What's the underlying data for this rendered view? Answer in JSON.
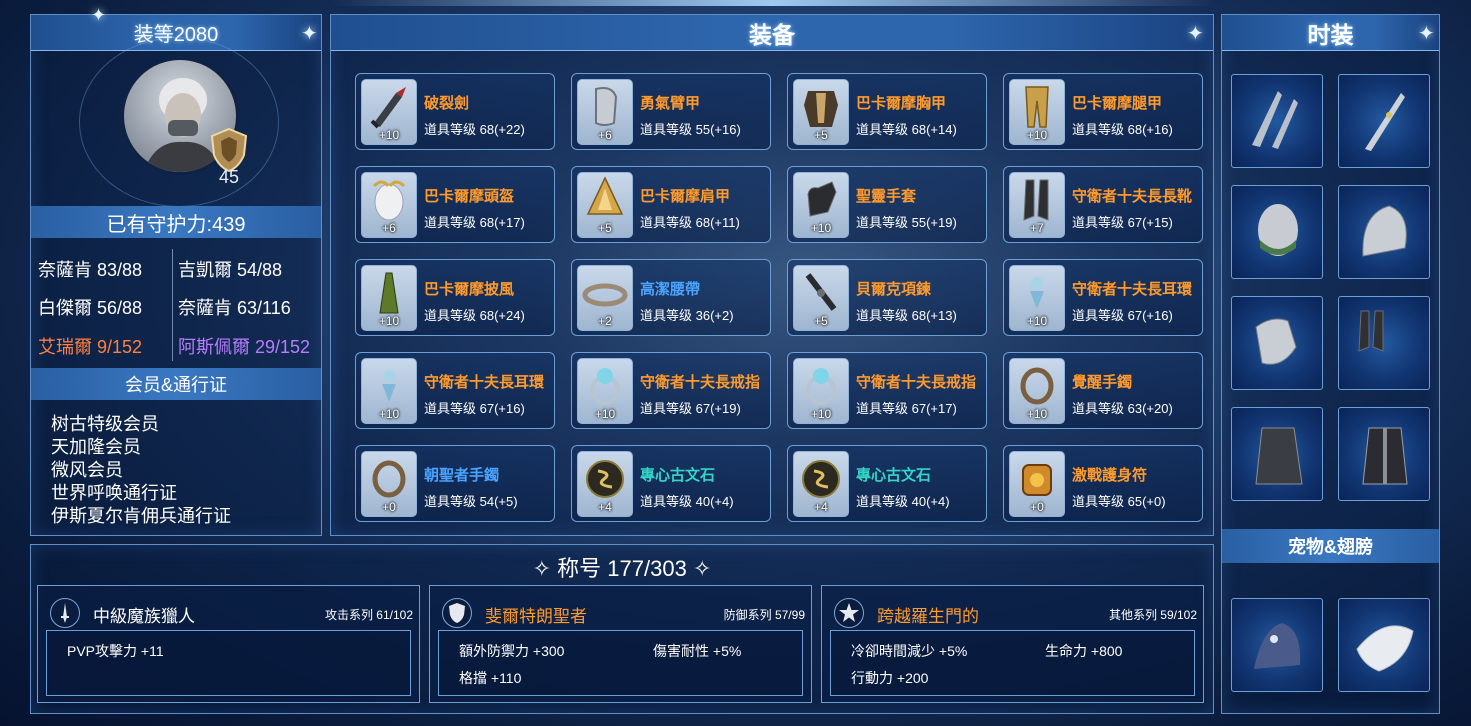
{
  "colors": {
    "orange": "#ff9a2b",
    "teal": "#35d6c8",
    "blue": "#4aa3ff",
    "purple": "#b77dff",
    "rare_orange": "#ff8040"
  },
  "left": {
    "gear_score": "装等2080",
    "avatar_level": "45",
    "guard_power": "已有守护力:439",
    "stats": [
      {
        "label": "奈薩肯 83/88"
      },
      {
        "label": "吉凱爾 54/88"
      },
      {
        "label": "白傑爾 56/88"
      },
      {
        "label": "奈薩肯 63/116"
      },
      {
        "label": "艾瑞爾 9/152"
      },
      {
        "label": "阿斯佩爾 29/152"
      }
    ],
    "membership_title": "会员&通行证",
    "memberships": [
      "树古特级会员",
      "天加隆会员",
      "微风会员",
      "世界呼唤通行证",
      "伊斯夏尔肯佣兵通行证"
    ]
  },
  "equipment": {
    "title": "装备",
    "items": [
      {
        "name": "破裂劍",
        "level": "道具等级 68(+22)",
        "plus": "+10",
        "color": "orange",
        "icon": "sword-icon"
      },
      {
        "name": "勇氣臂甲",
        "level": "道具等级 55(+16)",
        "plus": "+6",
        "color": "orange",
        "icon": "vambrace-icon"
      },
      {
        "name": "巴卡爾摩胸甲",
        "level": "道具等级 68(+14)",
        "plus": "+5",
        "color": "orange",
        "icon": "chest-armor-icon"
      },
      {
        "name": "巴卡爾摩腿甲",
        "level": "道具等级 68(+16)",
        "plus": "+10",
        "color": "orange",
        "icon": "leg-armor-icon"
      },
      {
        "name": "巴卡爾摩頭盔",
        "level": "道具等级 68(+17)",
        "plus": "+6",
        "color": "orange",
        "icon": "helmet-icon"
      },
      {
        "name": "巴卡爾摩肩甲",
        "level": "道具等级 68(+11)",
        "plus": "+5",
        "color": "orange",
        "icon": "shoulder-icon"
      },
      {
        "name": "聖靈手套",
        "level": "道具等级 55(+19)",
        "plus": "+10",
        "color": "orange",
        "icon": "glove-icon"
      },
      {
        "name": "守衛者十夫長長靴",
        "level": "道具等级 67(+15)",
        "plus": "+7",
        "color": "orange",
        "icon": "boots-icon"
      },
      {
        "name": "巴卡爾摩披風",
        "level": "道具等级 68(+24)",
        "plus": "+10",
        "color": "orange",
        "icon": "cape-icon"
      },
      {
        "name": "高潔腰帶",
        "level": "道具等级 36(+2)",
        "plus": "+2",
        "color": "blue",
        "icon": "belt-icon"
      },
      {
        "name": "貝爾克項鍊",
        "level": "道具等级 68(+13)",
        "plus": "+5",
        "color": "orange",
        "icon": "necklace-icon"
      },
      {
        "name": "守衛者十夫長耳環",
        "level": "道具等级 67(+16)",
        "plus": "+10",
        "color": "orange",
        "icon": "earring-icon"
      },
      {
        "name": "守衛者十夫長耳環",
        "level": "道具等级 67(+16)",
        "plus": "+10",
        "color": "orange",
        "icon": "earring-icon"
      },
      {
        "name": "守衛者十夫長戒指",
        "level": "道具等级 67(+19)",
        "plus": "+10",
        "color": "orange",
        "icon": "ring-icon"
      },
      {
        "name": "守衛者十夫長戒指",
        "level": "道具等级 67(+17)",
        "plus": "+10",
        "color": "orange",
        "icon": "ring-icon"
      },
      {
        "name": "覺醒手鐲",
        "level": "道具等级 63(+20)",
        "plus": "+10",
        "color": "orange",
        "icon": "bracelet-icon"
      },
      {
        "name": "朝聖者手鐲",
        "level": "道具等级 54(+5)",
        "plus": "+0",
        "color": "blue",
        "icon": "bracelet-icon"
      },
      {
        "name": "專心古文石",
        "level": "道具等级 40(+4)",
        "plus": "+4",
        "color": "teal",
        "icon": "rune-stone-icon"
      },
      {
        "name": "專心古文石",
        "level": "道具等级 40(+4)",
        "plus": "+4",
        "color": "teal",
        "icon": "rune-stone-icon"
      },
      {
        "name": "激戰護身符",
        "level": "道具等级 65(+0)",
        "plus": "+0",
        "color": "orange",
        "icon": "amulet-icon"
      }
    ]
  },
  "fashion": {
    "title": "时装",
    "items": [
      "wing-weapon-icon",
      "dagger-icon",
      "mask-icon",
      "shoulder-guard-icon",
      "gauntlet-icon",
      "boots-icon",
      "cloak-icon",
      "coat-icon"
    ],
    "pet_title": "宠物&翅膀",
    "pets": [
      "pet-creature-icon",
      "feather-wing-icon"
    ]
  },
  "titles": {
    "header": "称号 177/303",
    "panels": [
      {
        "name": "中級魔族獵人",
        "name_color": "#ffffff",
        "category": "攻击系列 61/102",
        "icon": "sword-badge-icon",
        "effects": [
          "PVP攻擊力 +11"
        ]
      },
      {
        "name": "斐爾特朗聖者",
        "name_color": "#ff9a2b",
        "category": "防御系列 57/99",
        "icon": "shield-badge-icon",
        "effects": [
          "額外防禦力 +300",
          "傷害耐性 +5%",
          "格擋 +110"
        ]
      },
      {
        "name": "跨越羅生門的",
        "name_color": "#ff9a2b",
        "category": "其他系列 59/102",
        "icon": "star-badge-icon",
        "effects": [
          "冷卻時間減少 +5%",
          "生命力 +800",
          "行動力 +200"
        ]
      }
    ]
  }
}
